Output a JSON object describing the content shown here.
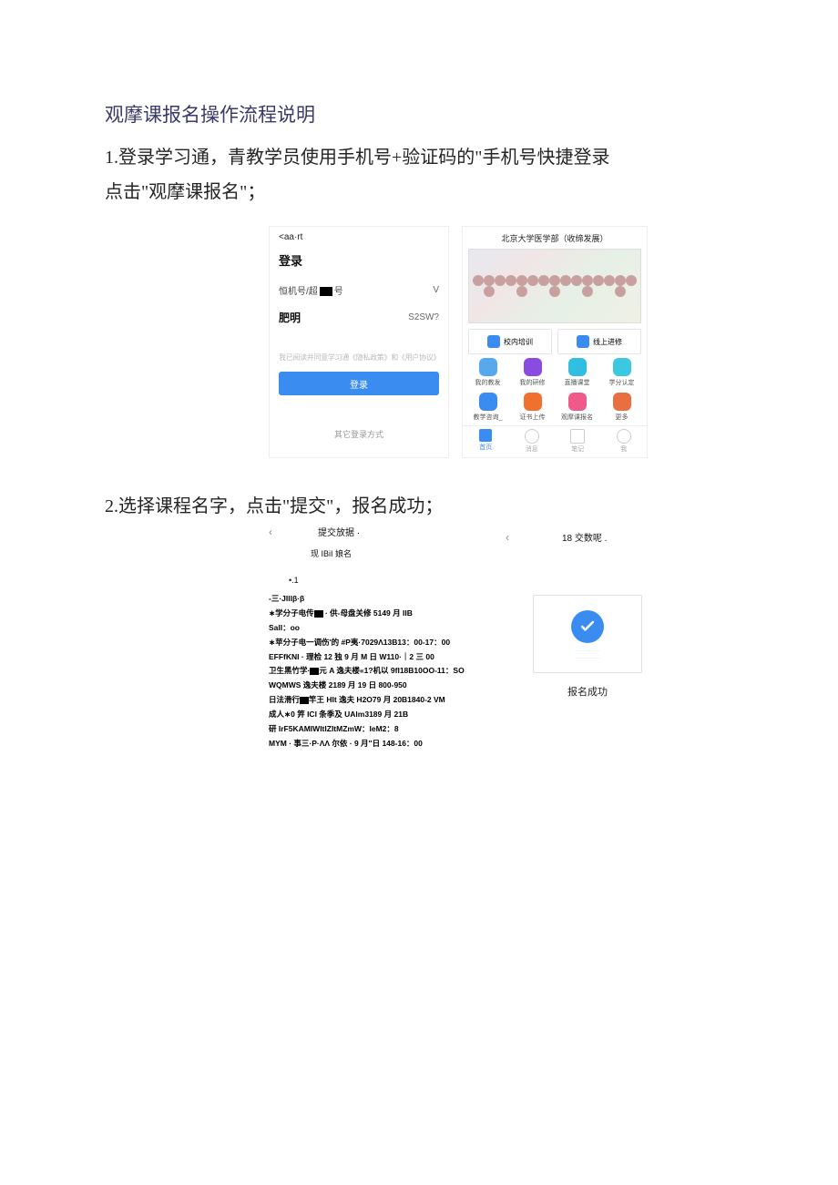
{
  "title": "观摩课报名操作流程说明",
  "step1_line1": "1.登录学习通，青教学员使用手机号+验证码的\"手机号快捷登录",
  "step1_line2": "点击\"观摩课报名\"；",
  "phone_a": {
    "status": "<aa·rt",
    "login": "登录",
    "phone_field_left": "恒机号/超",
    "phone_field_right": "号",
    "v": "V",
    "name": "肥明",
    "code": "S2SW?",
    "hint": "我已阅读并同意学习通《隐私政策》和《用户协议》",
    "btn": "登录",
    "other": "其它登录方式"
  },
  "phone_b": {
    "header": "北京大学医学部（收缔发展）",
    "wide": [
      "校内培训",
      "线上进修"
    ],
    "row1": [
      "我的教发",
      "我的研修",
      "直播课堂",
      "学分认定"
    ],
    "row2": [
      "教学咨询_",
      "证书上传",
      "观摩课报名",
      "更多"
    ],
    "tabs": [
      "首页",
      "消息",
      "笔记",
      "我"
    ]
  },
  "step2": "2.选择课程名字，点击\"提交\"，报名成功；",
  "panel_left": {
    "back": "‹",
    "hd": "提交放据 ·",
    "sub": "现 IBiI 娘名",
    "n1": "•.1",
    "lines": [
      "-三·JIlIβ·β",
      "∗学分子电传■ · 供-母盘关修 5149 月 IIB",
      "SalI：oo",
      "∗苹分子电一调伤'的 #P夷·7029Λ13B13：00-17：00",
      "EFFfKNI · 理检 12 独 9 月 M 日 W110·｜2 三 00",
      "卫生黑竹学·■元 A 逸夫楼«1?机以 9fI18B10OO-11：SO",
      "WQMWS 逸夫楼 2189 月 19 日 800-950",
      "日法滑行■竿王 HIt 逸夫 H2O79 月 20B1840-2 VM",
      "成人∗0 笄 ICI 条季及 UAlm3189 月 21B",
      "研 IrF5KAMIWItIZItMZmW：IeM2：8",
      "MYM · 事三·P·ΛΛ 尔依 · 9 月\"日 148-16：00"
    ]
  },
  "panel_right": {
    "back": "‹",
    "hd": "18 交数呢 .",
    "success": "报名成功"
  }
}
